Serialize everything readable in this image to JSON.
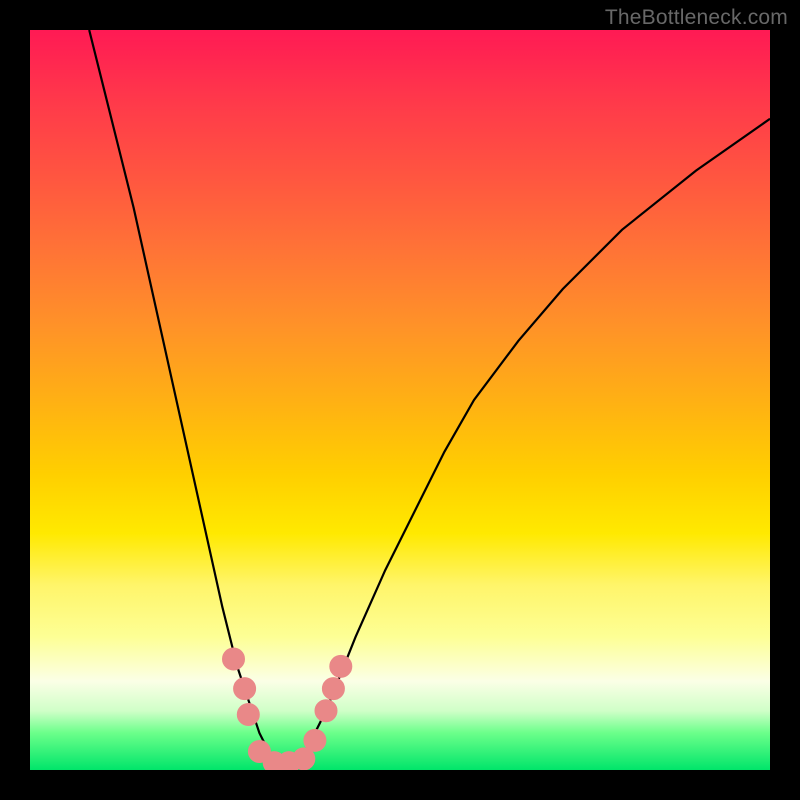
{
  "watermark": "TheBottleneck.com",
  "chart_data": {
    "type": "line",
    "title": "",
    "xlabel": "",
    "ylabel": "",
    "xlim": [
      0,
      100
    ],
    "ylim": [
      0,
      100
    ],
    "grid": false,
    "legend": false,
    "series": [
      {
        "name": "curve",
        "x": [
          8,
          10,
          12,
          14,
          16,
          18,
          20,
          22,
          24,
          26,
          28,
          29,
          30,
          31,
          32,
          33,
          34,
          35,
          36,
          37,
          38,
          40,
          42,
          44,
          48,
          52,
          56,
          60,
          66,
          72,
          80,
          90,
          100
        ],
        "y": [
          100,
          92,
          84,
          76,
          67,
          58,
          49,
          40,
          31,
          22,
          14,
          11,
          8,
          5,
          3,
          1,
          0,
          0,
          1,
          2,
          4,
          8,
          13,
          18,
          27,
          35,
          43,
          50,
          58,
          65,
          73,
          81,
          88
        ]
      }
    ],
    "markers": [
      {
        "x": 27.5,
        "y": 15
      },
      {
        "x": 29,
        "y": 11
      },
      {
        "x": 29.5,
        "y": 7.5
      },
      {
        "x": 31,
        "y": 2.5
      },
      {
        "x": 33,
        "y": 1
      },
      {
        "x": 35,
        "y": 1
      },
      {
        "x": 37,
        "y": 1.5
      },
      {
        "x": 38.5,
        "y": 4
      },
      {
        "x": 40,
        "y": 8
      },
      {
        "x": 41,
        "y": 11
      },
      {
        "x": 42,
        "y": 14
      }
    ],
    "colors": {
      "curve": "#000000",
      "marker_fill": "#e98888",
      "marker_stroke": "#e98888"
    }
  }
}
